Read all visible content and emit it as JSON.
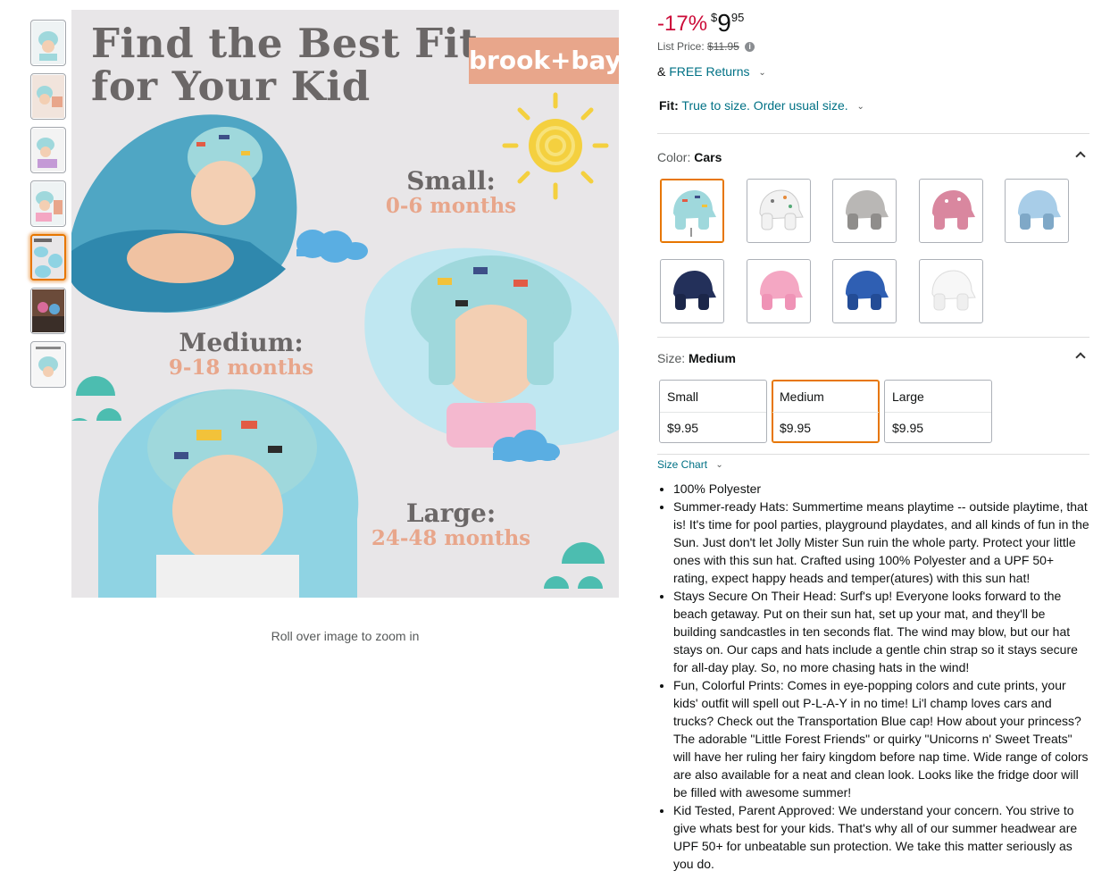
{
  "gallery": {
    "thumbnails": [
      {
        "label": "Product image 1"
      },
      {
        "label": "Product image 2"
      },
      {
        "label": "Product image 3"
      },
      {
        "label": "Product image 4"
      },
      {
        "label": "Product image 5",
        "active": true
      },
      {
        "label": "Product image 6"
      },
      {
        "label": "Product image 7"
      }
    ],
    "main_image": {
      "title_line1": "Find the Best Fit",
      "title_line2": "for Your Kid",
      "brand": "brook+bay",
      "sizes": [
        {
          "name": "Small:",
          "range": "0-6 months"
        },
        {
          "name": "Medium:",
          "range": "9-18 months"
        },
        {
          "name": "Large:",
          "range": "24-48 months"
        }
      ]
    },
    "zoom_hint": "Roll over image to zoom in"
  },
  "pricing": {
    "discount": "-17%",
    "currency_symbol": "$",
    "price_whole": "9",
    "price_fraction": "95",
    "list_price_label": "List Price:",
    "list_price": "$11.95",
    "returns_prefix": "&",
    "returns_link": "FREE Returns"
  },
  "fit": {
    "label": "Fit:",
    "value": "True to size. Order usual size."
  },
  "color": {
    "label": "Color:",
    "selected": "Cars",
    "swatches": [
      {
        "name": "Cars",
        "color": "#9fd8dc",
        "selected": true
      },
      {
        "name": "Dino",
        "color": "#f2f2f2"
      },
      {
        "name": "Grey",
        "color": "#b9b7b5"
      },
      {
        "name": "Pink Print",
        "color": "#d9879f"
      },
      {
        "name": "Light Blue",
        "color": "#a8cde8"
      },
      {
        "name": "Navy",
        "color": "#23305a"
      },
      {
        "name": "Pink",
        "color": "#f4a7c3"
      },
      {
        "name": "Royal Blue",
        "color": "#2f5fb3"
      },
      {
        "name": "White",
        "color": "#f7f7f7"
      }
    ]
  },
  "size": {
    "label": "Size:",
    "selected": "Medium",
    "options": [
      {
        "name": "Small",
        "price": "$9.95"
      },
      {
        "name": "Medium",
        "price": "$9.95",
        "selected": true
      },
      {
        "name": "Large",
        "price": "$9.95"
      }
    ],
    "chart_link": "Size Chart"
  },
  "bullets": [
    "100% Polyester",
    "Summer-ready Hats: Summertime means playtime -- outside playtime, that is! It's time for pool parties, playground playdates, and all kinds of fun in the Sun. Just don't let Jolly Mister Sun ruin the whole party. Protect your little ones with this sun hat. Crafted using 100% Polyester and a UPF 50+ rating, expect happy heads and temper(atures) with this sun hat!",
    "Stays Secure On Their Head: Surf's up! Everyone looks forward to the beach getaway. Put on their sun hat, set up your mat, and they'll be building sandcastles in ten seconds flat. The wind may blow, but our hat stays on. Our caps and hats include a gentle chin strap so it stays secure for all-day play. So, no more chasing hats in the wind!",
    "Fun, Colorful Prints: Comes in eye-popping colors and cute prints, your kids' outfit will spell out P-L-A-Y in no time! Li'l champ loves cars and trucks? Check out the Transportation Blue cap! How about your princess? The adorable \"Little Forest Friends\" or quirky \"Unicorns n' Sweet Treats\" will have her ruling her fairy kingdom before nap time. Wide range of colors are also available for a neat and clean look. Looks like the fridge door will be filled with awesome summer!",
    "Kid Tested, Parent Approved: We understand your concern. You strive to give whats best for your kids. That's why all of our summer headwear are UPF 50+ for unbeatable sun protection. We take this matter seriously as you do."
  ]
}
